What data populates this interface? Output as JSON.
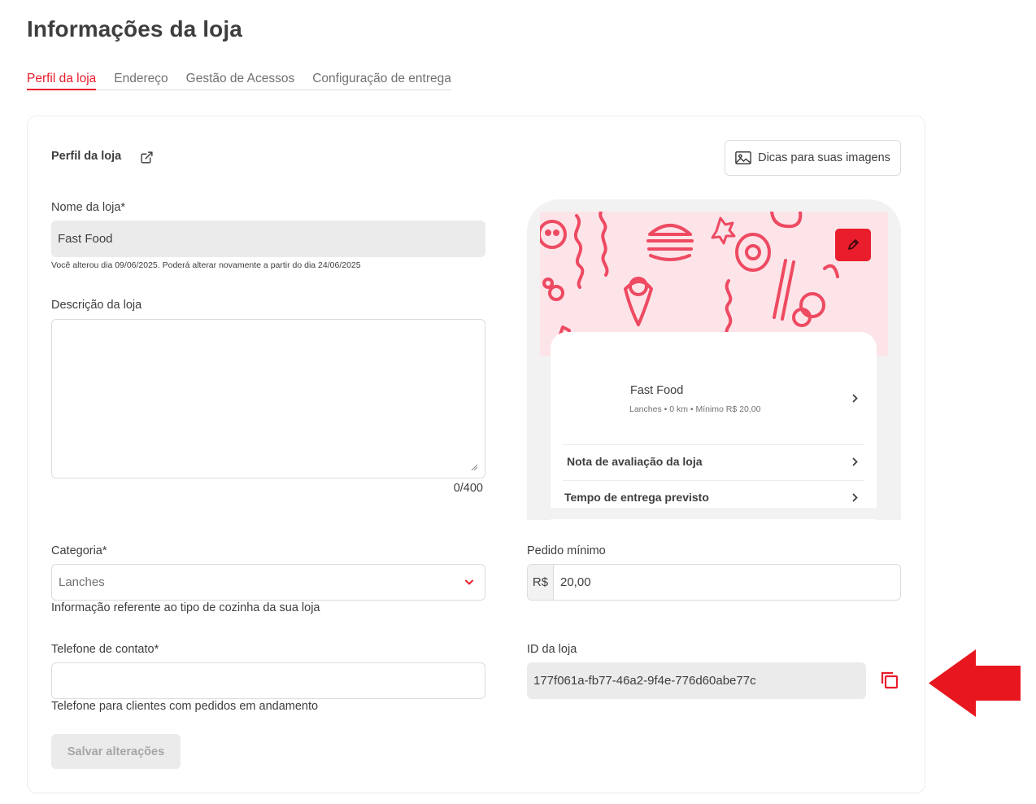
{
  "page": {
    "title": "Informações da loja"
  },
  "tabs": [
    {
      "label": "Perfil da loja",
      "active": true
    },
    {
      "label": "Endereço",
      "active": false
    },
    {
      "label": "Gestão de Acessos",
      "active": false
    },
    {
      "label": "Configuração de entrega",
      "active": false
    }
  ],
  "section": {
    "title": "Perfil da loja",
    "tips_button": "Dicas para suas imagens"
  },
  "store_name": {
    "label": "Nome da loja*",
    "value": "Fast Food",
    "note": "Você alterou dia 09/06/2025. Poderá alterar novamente a partir do dia 24/06/2025"
  },
  "description": {
    "label": "Descrição da loja",
    "value": "",
    "counter": "0/400"
  },
  "category": {
    "label": "Categoria*",
    "selected": "Lanches",
    "helper": "Informação referente ao tipo de cozinha da sua loja"
  },
  "phone": {
    "label": "Telefone de contato*",
    "value": "",
    "helper": "Telefone para clientes com pedidos em andamento"
  },
  "min_order": {
    "label": "Pedido mínimo",
    "prefix": "R$",
    "value": "20,00"
  },
  "store_id": {
    "label": "ID da loja",
    "value": "177f061a-fb77-46a2-9f4e-776d60abe77c"
  },
  "save_button": "Salvar alterações",
  "preview": {
    "store_name": "Fast Food",
    "meta": "Lanches • 0 km • Mínimo R$ 20,00",
    "rows": [
      "Nota de avaliação da loja",
      "Tempo de entrega previsto"
    ]
  },
  "colors": {
    "accent": "#ea1d2c",
    "text": "#3e3e3e",
    "muted": "#717171",
    "disabled_bg": "#ebebeb",
    "banner_bg": "#fde4e8",
    "arrow": "#e8171f"
  },
  "icons": {
    "external_link": "external-link-icon",
    "image": "image-icon",
    "edit": "pencil-icon",
    "copy": "copy-icon",
    "select_arrow": "chevron-down-icon",
    "row_arrow": "chevron-right-icon"
  }
}
